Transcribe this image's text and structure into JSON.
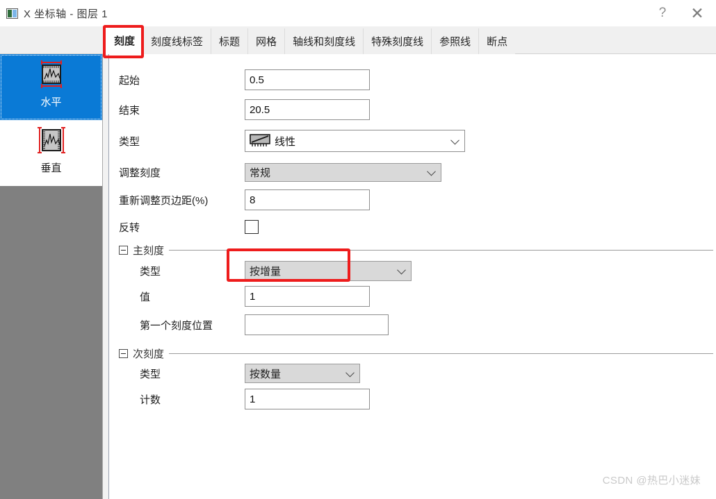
{
  "window": {
    "title": "X 坐标轴 - 图层 1",
    "icon": "axis-dialog-icon",
    "help_label": "?",
    "close_label": "✕"
  },
  "tabs": [
    {
      "label": "刻度",
      "active": true
    },
    {
      "label": "刻度线标签",
      "active": false
    },
    {
      "label": "标题",
      "active": false
    },
    {
      "label": "网格",
      "active": false
    },
    {
      "label": "轴线和刻度线",
      "active": false
    },
    {
      "label": "特殊刻度线",
      "active": false
    },
    {
      "label": "参照线",
      "active": false
    },
    {
      "label": "断点",
      "active": false
    }
  ],
  "sidebar": {
    "items": [
      {
        "label": "水平",
        "icon": "horizontal-axis-icon",
        "selected": true
      },
      {
        "label": "垂直",
        "icon": "vertical-axis-icon",
        "selected": false
      }
    ]
  },
  "form": {
    "begin": {
      "label": "起始",
      "value": "0.5"
    },
    "end": {
      "label": "结束",
      "value": "20.5"
    },
    "type": {
      "label": "类型",
      "value": "线性",
      "icon": "linear-scale-icon"
    },
    "rescale": {
      "label": "调整刻度",
      "value": "常规"
    },
    "margin": {
      "label": "重新调整页边距(%)",
      "value": "8"
    },
    "reverse": {
      "label": "反转",
      "checked": false
    },
    "major": {
      "group_label": "主刻度",
      "type": {
        "label": "类型",
        "value": "按增量"
      },
      "value": {
        "label": "值",
        "value": "1"
      },
      "first_tick": {
        "label": "第一个刻度位置",
        "value": ""
      }
    },
    "minor": {
      "group_label": "次刻度",
      "type": {
        "label": "类型",
        "value": "按数量"
      },
      "count": {
        "label": "计数",
        "value": "1"
      }
    }
  },
  "annotations": {
    "color": "#ee1c1c",
    "boxes": [
      "active-tab-highlight",
      "major-type-highlight"
    ]
  },
  "watermark": {
    "text": "CSDN @热巴小迷妹"
  }
}
